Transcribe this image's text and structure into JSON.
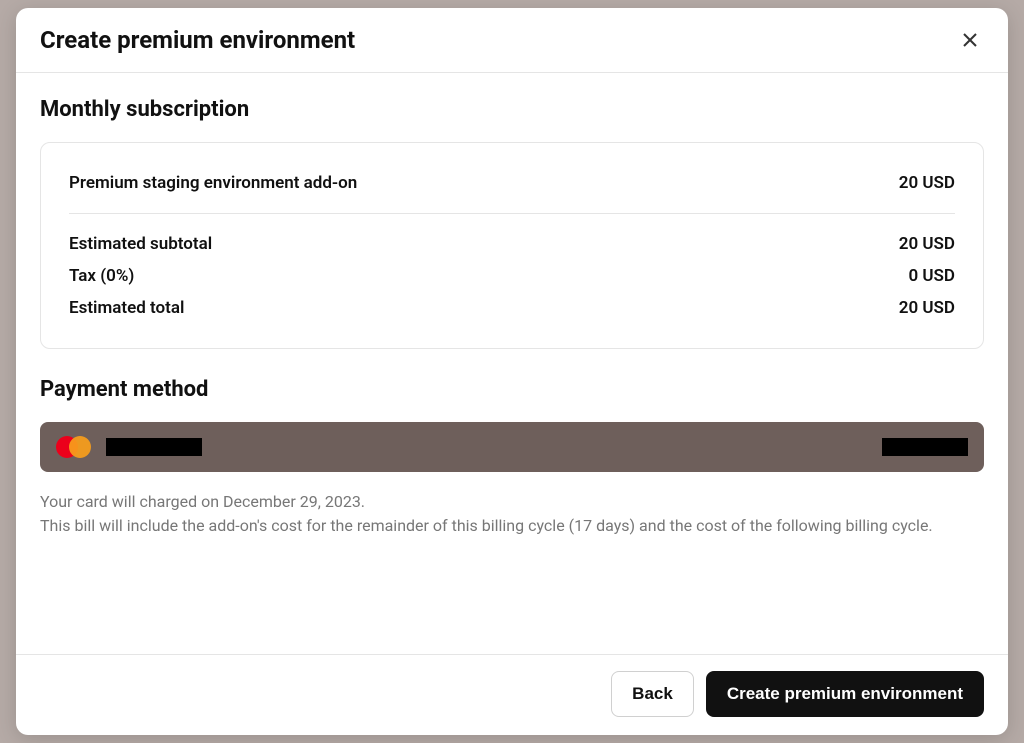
{
  "modal": {
    "title": "Create premium environment",
    "close_icon": "close-icon"
  },
  "subscription": {
    "heading": "Monthly subscription",
    "item": {
      "label": "Premium staging environment add-on",
      "amount": "20 USD"
    },
    "subtotal": {
      "label": "Estimated subtotal",
      "amount": "20 USD"
    },
    "tax": {
      "label": "Tax (0%)",
      "amount": "0 USD"
    },
    "total": {
      "label": "Estimated total",
      "amount": "20 USD"
    }
  },
  "payment": {
    "heading": "Payment method",
    "card_brand": "mastercard",
    "info_line1": "Your card will charged on December 29, 2023.",
    "info_line2": "This bill will include the add-on's cost for the remainder of this billing cycle (17 days) and the cost of the following billing cycle."
  },
  "footer": {
    "back_label": "Back",
    "submit_label": "Create premium environment"
  }
}
